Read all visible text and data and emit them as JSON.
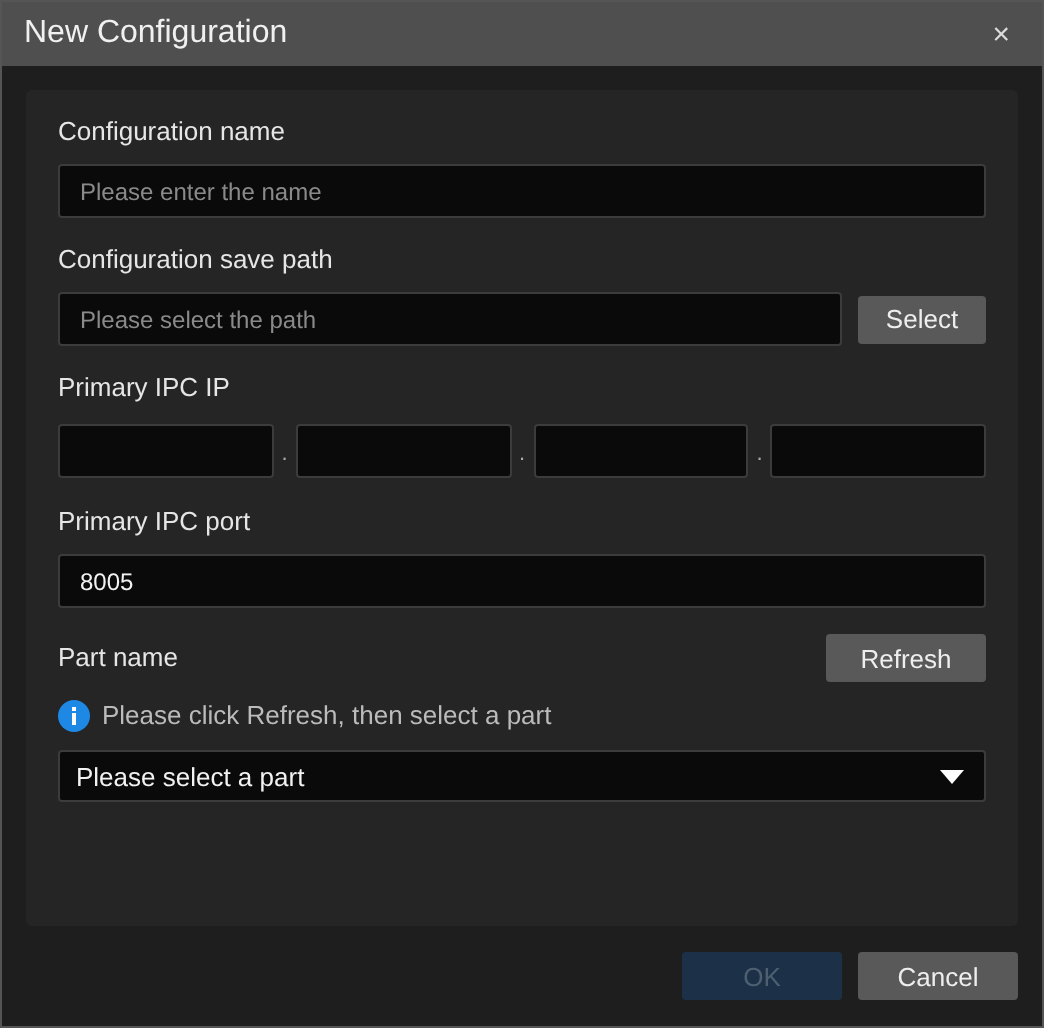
{
  "window": {
    "title": "New Configuration",
    "close": "×"
  },
  "form": {
    "name": {
      "label": "Configuration name",
      "placeholder": "Please enter the name"
    },
    "path": {
      "label": "Configuration save path",
      "placeholder": "Please select the path",
      "button": "Select"
    },
    "ip": {
      "label": "Primary IPC IP",
      "separators": [
        ".",
        ".",
        "."
      ]
    },
    "port": {
      "label": "Primary IPC port",
      "value": "8005"
    },
    "part": {
      "label": "Part name",
      "button": "Refresh",
      "hint": "Please click Refresh, then select a part",
      "select": "Please select a part"
    }
  },
  "buttons": [
    {
      "label": "OK",
      "disabled": true,
      "kind": "primary"
    },
    {
      "label": "Cancel",
      "disabled": false,
      "kind": "secondary"
    }
  ]
}
